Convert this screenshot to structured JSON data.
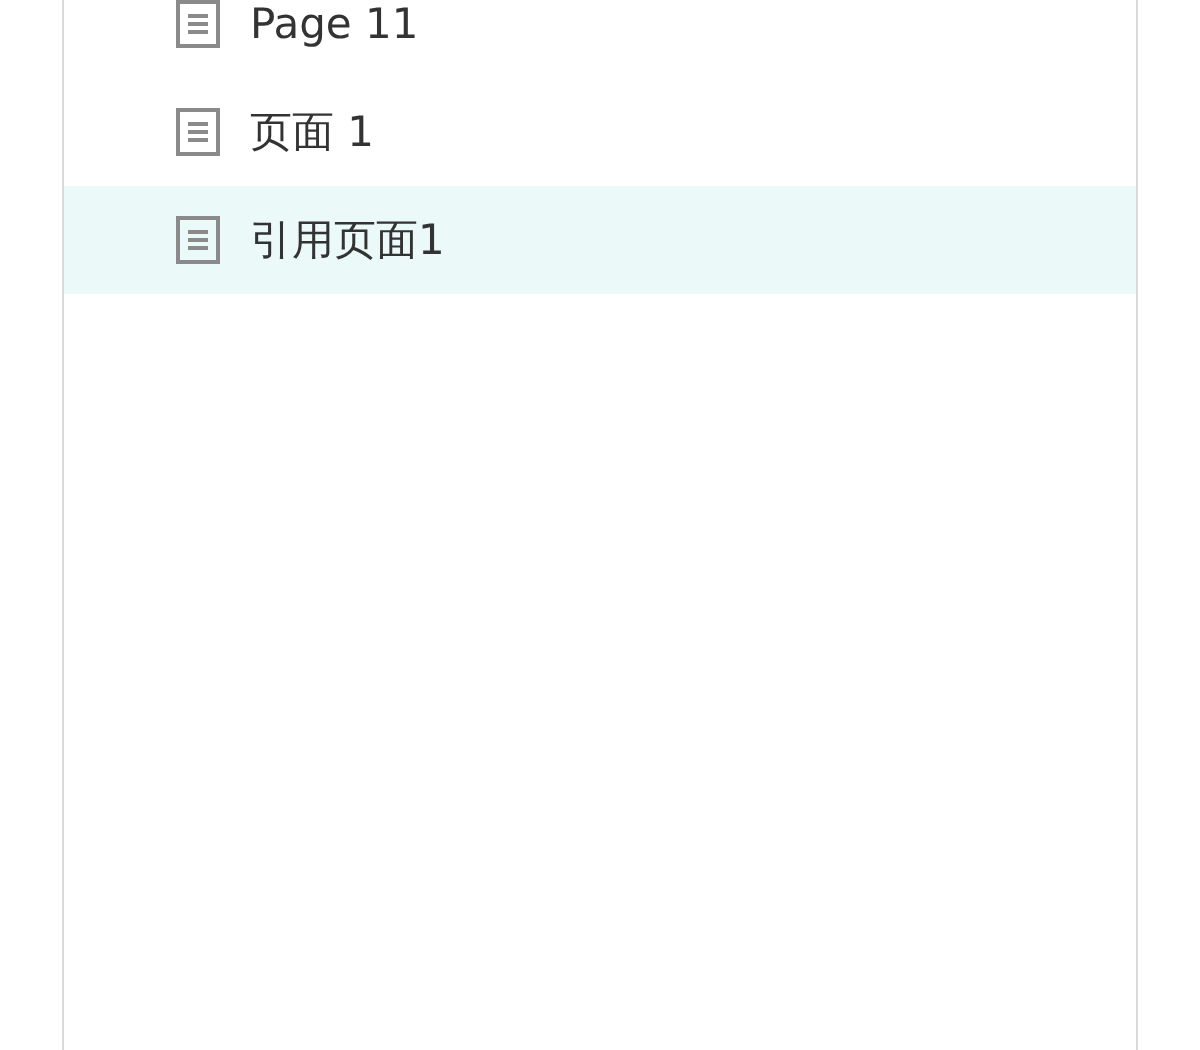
{
  "pages": [
    {
      "label": "Page 11",
      "selected": false
    },
    {
      "label": "页面 1",
      "selected": false
    },
    {
      "label": "引用页面1",
      "selected": true
    }
  ]
}
